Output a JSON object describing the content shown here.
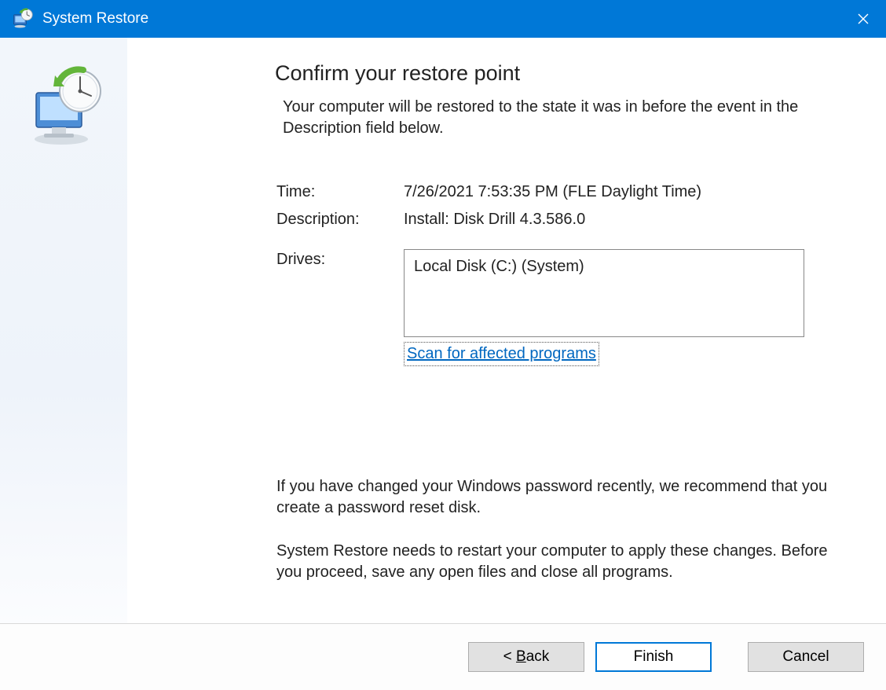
{
  "titlebar": {
    "title": "System Restore"
  },
  "page": {
    "heading": "Confirm your restore point",
    "intro": "Your computer will be restored to the state it was in before the event in the Description field below.",
    "time_label": "Time:",
    "time_value": "7/26/2021 7:53:35 PM (FLE Daylight Time)",
    "description_label": "Description:",
    "description_value": "Install: Disk Drill 4.3.586.0",
    "drives_label": "Drives:",
    "drives_value": "Local Disk (C:) (System)",
    "scan_link": "Scan for affected programs",
    "password_note": "If you have changed your Windows password recently, we recommend that you create a password reset disk.",
    "restart_note": "System Restore needs to restart your computer to apply these changes. Before you proceed, save any open files and close all programs."
  },
  "buttons": {
    "back_prefix": "< ",
    "back_u": "B",
    "back_rest": "ack",
    "finish": "Finish",
    "cancel": "Cancel"
  }
}
